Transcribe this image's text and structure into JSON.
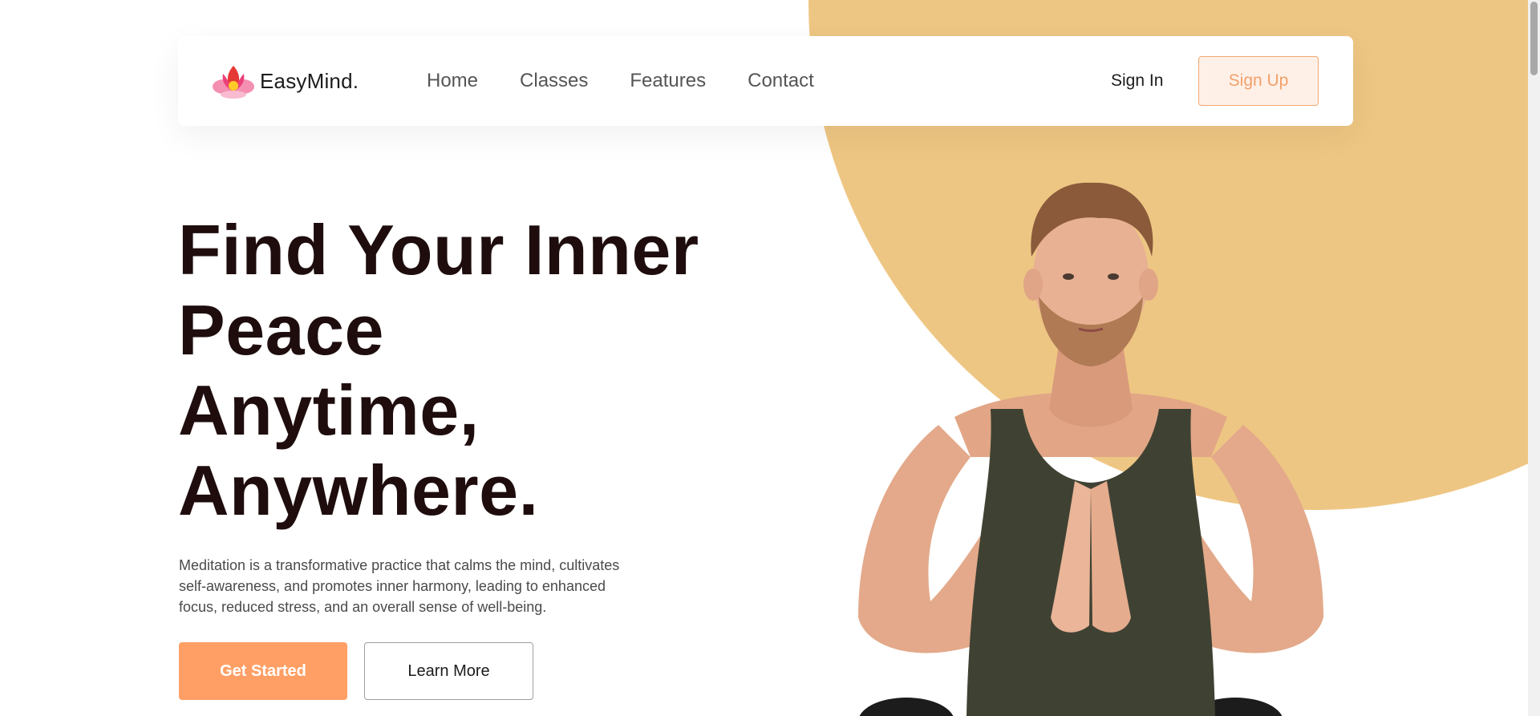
{
  "brand": {
    "name": "EasyMind.",
    "logo_icon": "lotus-icon"
  },
  "nav": {
    "links": [
      "Home",
      "Classes",
      "Features",
      "Contact"
    ],
    "sign_in": "Sign In",
    "sign_up": "Sign Up"
  },
  "hero": {
    "title_lines": [
      "Find Your Inner",
      "Peace",
      "Anytime,",
      "Anywhere."
    ],
    "description_lines": [
      "Meditation is a transformative practice that calms the mind, cultivates",
      "self-awareness, and promotes inner harmony, leading to enhanced",
      "focus, reduced stress, and an overall sense of well-being."
    ],
    "primary_button": "Get Started",
    "secondary_button": "Learn More"
  },
  "colors": {
    "accent": "#ff9f65",
    "sun": "#eec683",
    "heading": "#1f0d0e"
  }
}
